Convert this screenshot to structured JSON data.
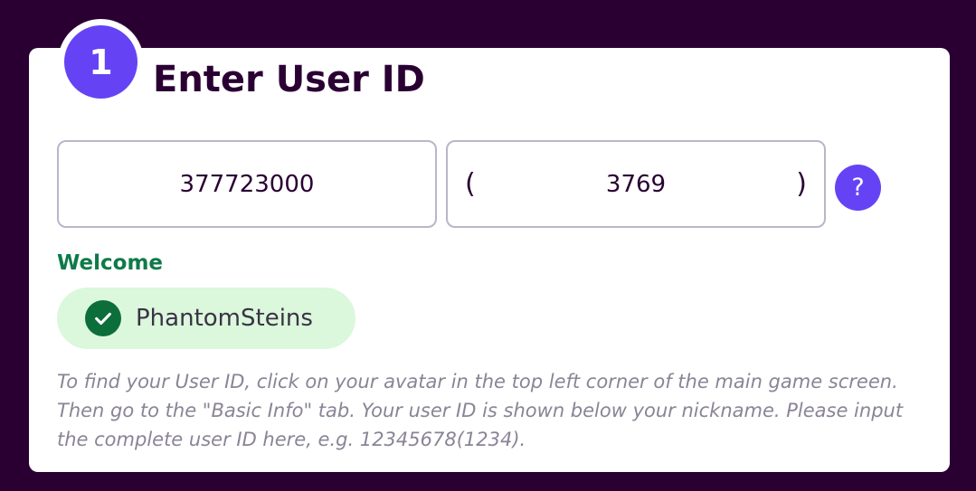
{
  "step": {
    "number": "1",
    "title": "Enter User ID"
  },
  "user_id_field": {
    "value": "377723000"
  },
  "server_field": {
    "open_paren": "(",
    "value": "3769",
    "close_paren": ")"
  },
  "help_button": {
    "label": "?",
    "icon": "question-icon"
  },
  "welcome": {
    "label": "Welcome",
    "username": "PhantomSteins",
    "icon": "checkmark-icon"
  },
  "hint_text": "To find your User ID, click on your avatar in the top left corner of the main game screen. Then go to the \"Basic Info\" tab. Your user ID is shown below your nickname. Please input the complete user ID here, e.g. 12345678(1234).",
  "colors": {
    "background": "#2a0033",
    "accent": "#6543f5",
    "success_text": "#0f7a48",
    "success_bg": "#dbf7dc"
  }
}
